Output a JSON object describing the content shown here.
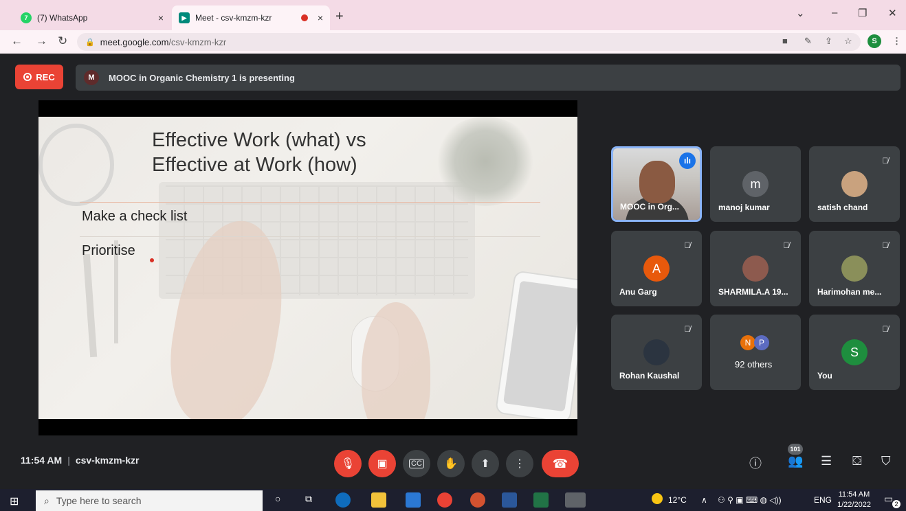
{
  "browser": {
    "tabs": [
      {
        "title": "(7) WhatsApp",
        "close": "×"
      },
      {
        "title": "Meet - csv-kmzm-kzr",
        "close": "×"
      }
    ],
    "new_tab": "+",
    "url_host": "meet.google.com",
    "url_path": "/csv-kmzm-kzr",
    "profile_initial": "S"
  },
  "meet": {
    "rec_label": "REC",
    "presenter_initial": "M",
    "presenting_text": "MOOC in Organic Chemistry 1 is presenting",
    "slide": {
      "title_line1": "Effective Work (what) vs",
      "title_line2": "Effective at Work (how)",
      "bullets": [
        "Make a check list",
        "Prioritise"
      ]
    },
    "participants": [
      {
        "name": "MOOC in Org...",
        "initial": "",
        "speaking": true
      },
      {
        "name": "manoj kumar",
        "initial": "m",
        "color": "#5f6368"
      },
      {
        "name": "satish chand",
        "initial": ""
      },
      {
        "name": "Anu Garg",
        "initial": "A",
        "color": "#e8590c"
      },
      {
        "name": "SHARMILA.A 19...",
        "initial": ""
      },
      {
        "name": "Harimohan me...",
        "initial": ""
      },
      {
        "name": "Rohan Kaushal",
        "initial": ""
      },
      {
        "name": "92 others",
        "initials": [
          "N",
          "P"
        ]
      },
      {
        "name": "You",
        "initial": "S",
        "color": "#1e8e3e"
      }
    ],
    "time": "11:54 AM",
    "separator": "|",
    "meeting_code": "csv-kmzm-kzr",
    "people_count": "101"
  },
  "taskbar": {
    "search_placeholder": "Type here to search",
    "weather": "12°C",
    "lang": "ENG",
    "clock_time": "11:54 AM",
    "clock_date": "1/22/2022",
    "notif_count": "2"
  }
}
